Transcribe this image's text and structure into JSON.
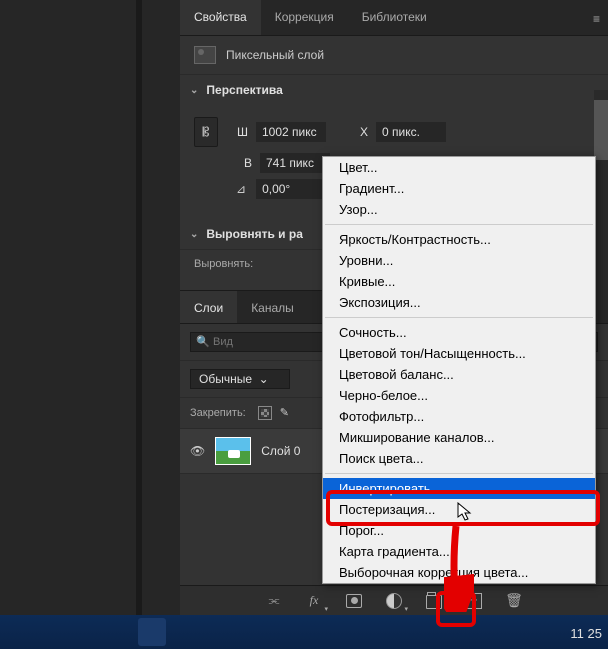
{
  "tabs": {
    "properties": "Свойства",
    "correction": "Коррекция",
    "libraries": "Библиотеки"
  },
  "layer_type": "Пиксельный слой",
  "perspective": {
    "title": "Перспектива",
    "w_label": "Ш",
    "w_value": "1002 пикс",
    "x_label": "X",
    "x_value": "0 пикс.",
    "h_label": "В",
    "h_value": "741 пикс",
    "angle_value": "0,00°"
  },
  "align": {
    "title": "Выровнять и ра",
    "label": "Выровнять:"
  },
  "layers_tabs": {
    "layers": "Слои",
    "channels": "Каналы"
  },
  "search_placeholder": "Вид",
  "blend_mode": "Обычные",
  "lock_label": "Закрепить:",
  "layer_name": "Слой 0",
  "context_menu": {
    "group1": [
      "Цвет...",
      "Градиент...",
      "Узор..."
    ],
    "group2": [
      "Яркость/Контрастность...",
      "Уровни...",
      "Кривые...",
      "Экспозиция..."
    ],
    "group3": [
      "Сочность...",
      "Цветовой тон/Насыщенность...",
      "Цветовой баланс...",
      "Черно-белое...",
      "Фотофильтр...",
      "Микширование каналов...",
      "Поиск цвета..."
    ],
    "group4": [
      "Инвертировать",
      "Постеризация...",
      "Порог...",
      "Карта градиента...",
      "Выборочная коррекция цвета..."
    ]
  },
  "highlighted_item": "Инвертировать",
  "clock": "11 25"
}
